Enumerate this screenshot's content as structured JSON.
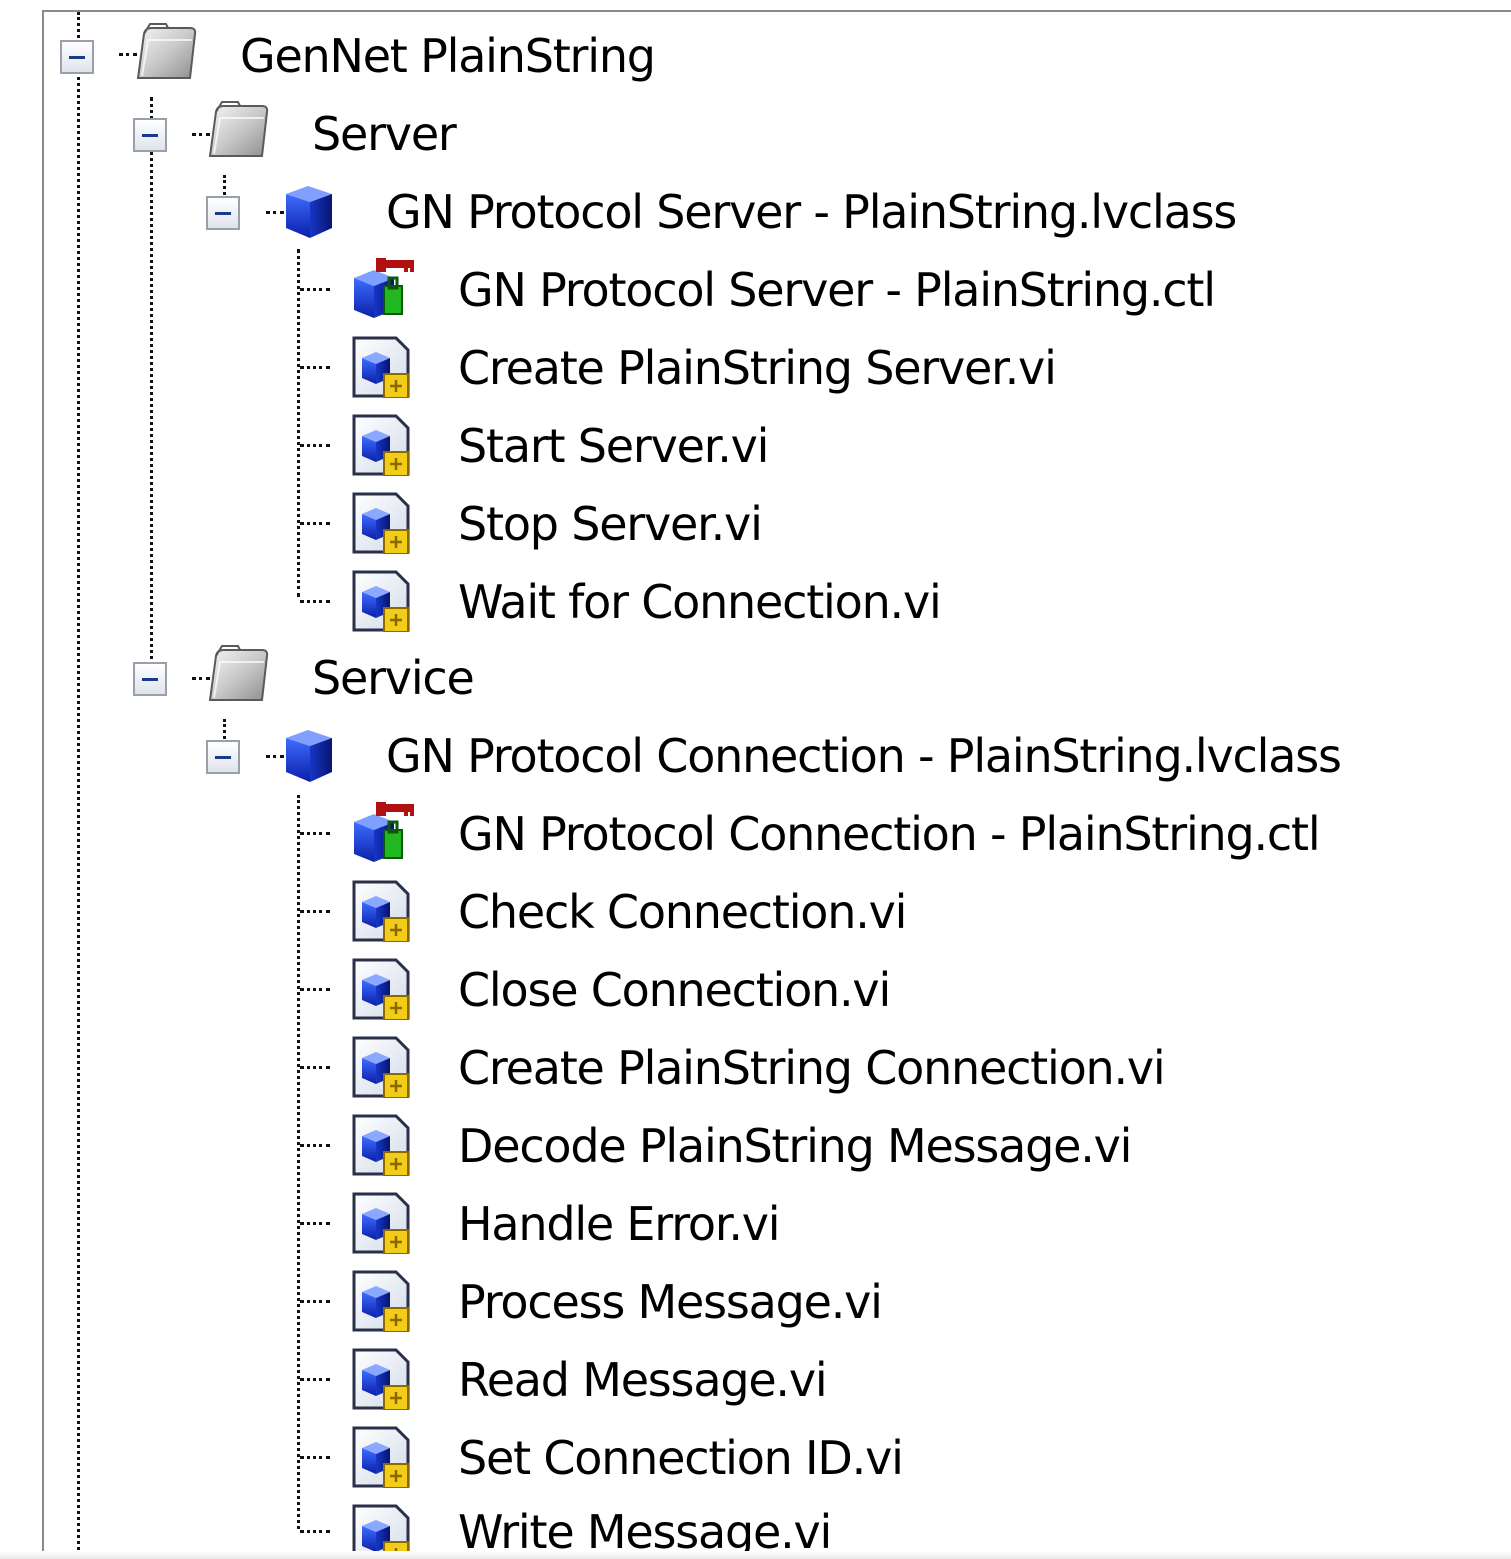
{
  "tree": {
    "root": {
      "label": "GenNet PlainString",
      "icon": "folder-icon",
      "expanded": true
    },
    "server_folder": {
      "label": "Server",
      "icon": "folder-icon",
      "expanded": true
    },
    "server_class": {
      "label": "GN Protocol Server - PlainString.lvclass",
      "icon": "lvclass-icon",
      "expanded": true
    },
    "server_items": [
      {
        "label": "GN Protocol Server - PlainString.ctl",
        "icon": "private-data-control-icon"
      },
      {
        "label": "Create PlainString Server.vi",
        "icon": "vi-icon"
      },
      {
        "label": "Start Server.vi",
        "icon": "vi-icon"
      },
      {
        "label": "Stop Server.vi",
        "icon": "vi-icon"
      },
      {
        "label": "Wait for Connection.vi",
        "icon": "vi-icon"
      }
    ],
    "service_folder": {
      "label": "Service",
      "icon": "folder-icon",
      "expanded": true
    },
    "service_class": {
      "label": "GN Protocol Connection - PlainString.lvclass",
      "icon": "lvclass-icon",
      "expanded": true
    },
    "service_items": [
      {
        "label": "GN Protocol Connection - PlainString.ctl",
        "icon": "private-data-control-icon"
      },
      {
        "label": "Check Connection.vi",
        "icon": "vi-icon"
      },
      {
        "label": "Close Connection.vi",
        "icon": "vi-icon"
      },
      {
        "label": "Create PlainString Connection.vi",
        "icon": "vi-icon"
      },
      {
        "label": "Decode PlainString Message.vi",
        "icon": "vi-icon"
      },
      {
        "label": "Handle Error.vi",
        "icon": "vi-icon"
      },
      {
        "label": "Process Message.vi",
        "icon": "vi-icon"
      },
      {
        "label": "Read Message.vi",
        "icon": "vi-icon"
      },
      {
        "label": "Set Connection ID.vi",
        "icon": "vi-icon"
      },
      {
        "label": "Write Message.vi",
        "icon": "vi-icon"
      }
    ]
  }
}
